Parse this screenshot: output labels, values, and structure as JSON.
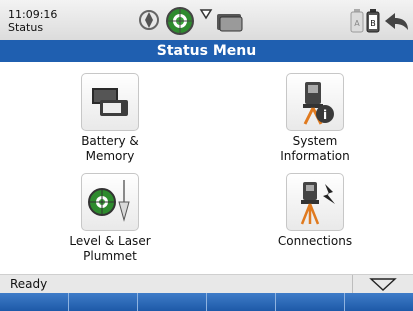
{
  "status_bar": {
    "time": "11:09:16",
    "context": "Status",
    "icons": [
      "instrument-icon",
      "target-icon",
      "prism-marker-icon",
      "controller-icon",
      "battery-a-icon",
      "battery-b-icon",
      "back-arrow-icon"
    ]
  },
  "title": "Status Menu",
  "menu": {
    "items": [
      {
        "label_line1": "Battery &",
        "label_line2": "Memory",
        "icon": "battery-memory-icon"
      },
      {
        "label_line1": "System",
        "label_line2": "Information",
        "icon": "system-info-icon"
      },
      {
        "label_line1": "Level & Laser",
        "label_line2": "Plummet",
        "icon": "level-laser-plummet-icon"
      },
      {
        "label_line1": "Connections",
        "label_line2": "",
        "icon": "connections-icon"
      }
    ]
  },
  "footer": {
    "status_text": "Ready",
    "dropdown_icon": "triangle-down-icon",
    "softkeys": [
      "",
      "",
      "",
      "",
      "",
      ""
    ]
  },
  "colors": {
    "accent": "#1f5fb0",
    "softkey": "#2b66b3"
  }
}
